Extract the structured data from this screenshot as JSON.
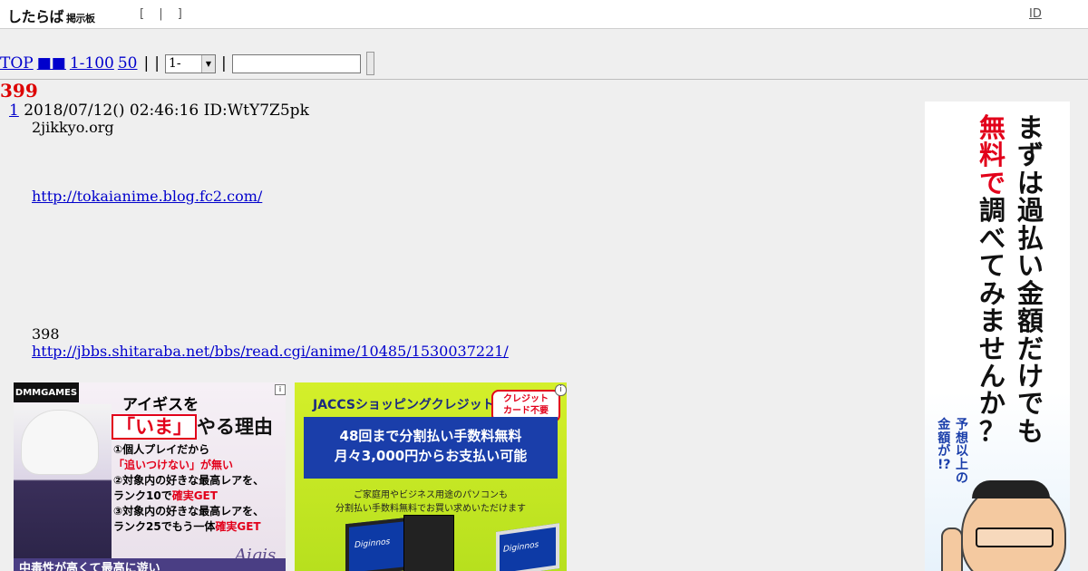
{
  "topbar": {
    "logo": "したらば",
    "logo_sub": "掲示板",
    "brackets": "[ | ]",
    "id_link": "ID"
  },
  "nav": {
    "top": "TOP",
    "squares": "■■",
    "range": "1-100",
    "last": "50",
    "sep1": "|",
    "sep2": "|",
    "sep3": "|",
    "select_value": "1-"
  },
  "thread": {
    "count": "399",
    "post": {
      "number": "1",
      "date": "2018/07/12() 02:46:16 ID:WtY7Z5pk",
      "lines": {
        "l1": "2jikkyo.org",
        "l2": "http://tokaianime.blog.fc2.com/",
        "l3": "398",
        "l4": "http://jbbs.shitaraba.net/bbs/read.cgi/anime/10485/1530037221/"
      }
    }
  },
  "ads": {
    "ad1": {
      "badge": "DMMGAMES",
      "headline1": "アイギスを",
      "headline2_red": "「いま」",
      "headline2_rest": "やる理由",
      "p1": "①個人プレイだから",
      "p1b": "「追いつけない」が無い",
      "p2": "②対象内の好きな最高レアを、",
      "p2b_pre": "ランク10で",
      "p2b_red": "確実GET",
      "p3": "③対象内の好きな最高レアを、",
      "p3b_pre": "ランク25でもう一体",
      "p3b_red": "確実GET",
      "bottom": "中毒性が高くて最高に遊い",
      "logo": "Aigis",
      "info": "i"
    },
    "ad2": {
      "brand": "JACCSショッピングクレジット",
      "tag1": "クレジット",
      "tag2": "カード不要",
      "blue1": "48回まで分割払い手数料無料",
      "blue2": "月々3,000円からお支払い可能",
      "small1": "ご家庭用やビジネス用途のパソコンも",
      "small2": "分割払い手数料無料でお買い求めいただけます",
      "pc_label": "Diginnos",
      "info": "i"
    },
    "ad3": {
      "col1": [
        "ま",
        "ず",
        "は",
        "過",
        "払",
        "い",
        "金",
        "額",
        "だ",
        "け",
        "で",
        "も"
      ],
      "col2_red": [
        "無",
        "料",
        "で"
      ],
      "col2_black": [
        "調",
        "べ",
        "て",
        "み",
        "ま",
        "せ",
        "ん",
        "か",
        "？"
      ],
      "col3": [
        "予",
        "想",
        "以",
        "上",
        "の"
      ],
      "col4": [
        "金",
        "額",
        "が",
        "!?"
      ]
    }
  },
  "colors": {
    "background": "#efefef",
    "link": "#0000cc",
    "count_red": "#dd0000"
  }
}
